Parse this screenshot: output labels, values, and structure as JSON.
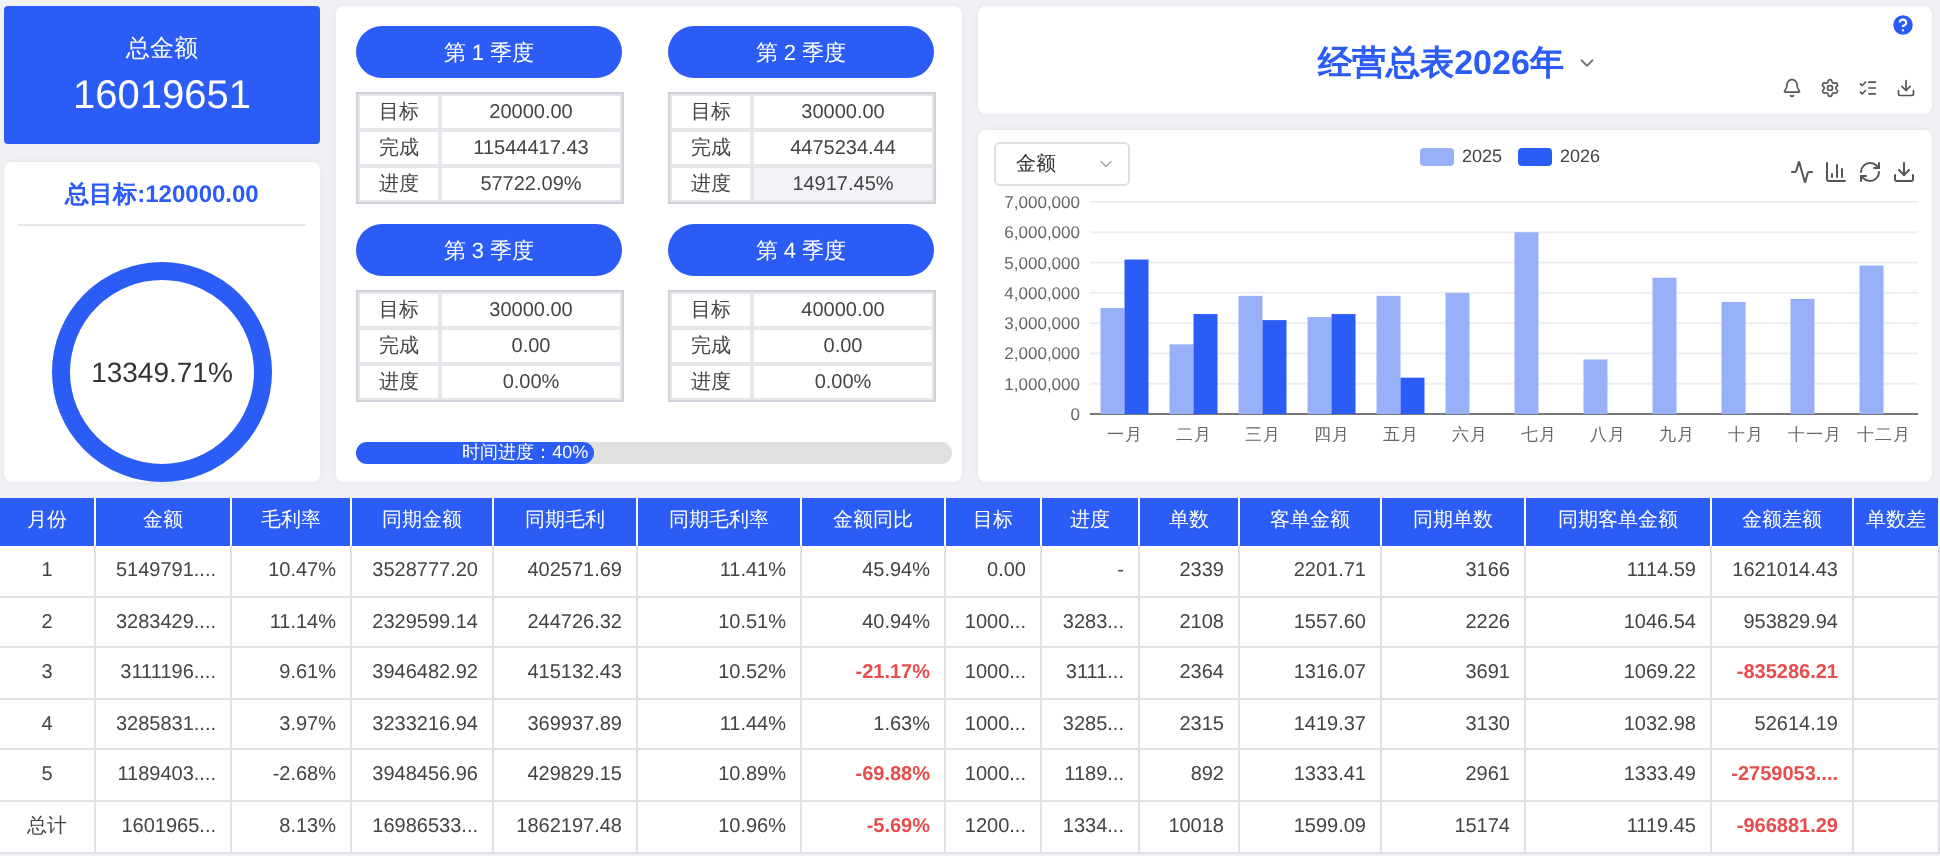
{
  "total_card": {
    "label": "总金额",
    "value": "16019651"
  },
  "target_card": {
    "title": "总目标:120000.00",
    "ring_value": "13349.71%"
  },
  "quarters": [
    {
      "title": "第 1 季度",
      "rows": [
        {
          "label": "目标",
          "value": "20000.00",
          "highlighted": false
        },
        {
          "label": "完成",
          "value": "11544417.43",
          "highlighted": false
        },
        {
          "label": "进度",
          "value": "57722.09%",
          "highlighted": false
        }
      ]
    },
    {
      "title": "第 2 季度",
      "rows": [
        {
          "label": "目标",
          "value": "30000.00",
          "highlighted": false
        },
        {
          "label": "完成",
          "value": "4475234.44",
          "highlighted": false
        },
        {
          "label": "进度",
          "value": "14917.45%",
          "highlighted": true
        }
      ]
    },
    {
      "title": "第 3 季度",
      "rows": [
        {
          "label": "目标",
          "value": "30000.00",
          "highlighted": false
        },
        {
          "label": "完成",
          "value": "0.00",
          "highlighted": false
        },
        {
          "label": "进度",
          "value": "0.00%",
          "highlighted": false
        }
      ]
    },
    {
      "title": "第 4 季度",
      "rows": [
        {
          "label": "目标",
          "value": "40000.00",
          "highlighted": false
        },
        {
          "label": "完成",
          "value": "0.00",
          "highlighted": false
        },
        {
          "label": "进度",
          "value": "0.00%",
          "highlighted": false
        }
      ]
    }
  ],
  "time_progress": {
    "label": "时间进度：40%",
    "level": 0.4
  },
  "header": {
    "title": "经营总表2026年"
  },
  "chart_panel": {
    "metric_select": "金额",
    "chart_data": {
      "type": "bar",
      "grid": true,
      "categories": [
        "一月",
        "二月",
        "三月",
        "四月",
        "五月",
        "六月",
        "七月",
        "八月",
        "九月",
        "十月",
        "十一月",
        "十二月"
      ],
      "series": [
        {
          "name": "2025",
          "color": "#98b0f8",
          "values": [
            3500000,
            2300000,
            3900000,
            3200000,
            3900000,
            4000000,
            6000000,
            1800000,
            4500000,
            3700000,
            3800000,
            4900000
          ]
        },
        {
          "name": "2026",
          "color": "#2b5cf6",
          "values": [
            5100000,
            3300000,
            3100000,
            3300000,
            1200000,
            null,
            null,
            null,
            null,
            null,
            null,
            null
          ]
        }
      ],
      "ylim": [
        0,
        7000000
      ],
      "yticks": [
        {
          "value": 0,
          "label": "0"
        },
        {
          "value": 1000000,
          "label": "1,000,000"
        },
        {
          "value": 2000000,
          "label": "2,000,000"
        },
        {
          "value": 3000000,
          "label": "3,000,000"
        },
        {
          "value": 4000000,
          "label": "4,000,000"
        },
        {
          "value": 5000000,
          "label": "5,000,000"
        },
        {
          "value": 6000000,
          "label": "6,000,000"
        },
        {
          "value": 7000000,
          "label": "7,000,000"
        }
      ]
    }
  },
  "table": {
    "columns": [
      "月份",
      "金额",
      "毛利率",
      "同期金额",
      "同期毛利",
      "同期毛利率",
      "金额同比",
      "目标",
      "进度",
      "单数",
      "客单金额",
      "同期单数",
      "同期客单金额",
      "金额差额",
      "单数差"
    ],
    "rows": [
      {
        "cells": [
          {
            "text": "1",
            "negative": false
          },
          {
            "text": "5149791....",
            "negative": false
          },
          {
            "text": "10.47%",
            "negative": false
          },
          {
            "text": "3528777.20",
            "negative": false
          },
          {
            "text": "402571.69",
            "negative": false
          },
          {
            "text": "11.41%",
            "negative": false
          },
          {
            "text": "45.94%",
            "negative": false
          },
          {
            "text": "0.00",
            "negative": false
          },
          {
            "text": "-",
            "negative": false
          },
          {
            "text": "2339",
            "negative": false
          },
          {
            "text": "2201.71",
            "negative": false
          },
          {
            "text": "3166",
            "negative": false
          },
          {
            "text": "1114.59",
            "negative": false
          },
          {
            "text": "1621014.43",
            "negative": false
          }
        ]
      },
      {
        "cells": [
          {
            "text": "2",
            "negative": false
          },
          {
            "text": "3283429....",
            "negative": false
          },
          {
            "text": "11.14%",
            "negative": false
          },
          {
            "text": "2329599.14",
            "negative": false
          },
          {
            "text": "244726.32",
            "negative": false
          },
          {
            "text": "10.51%",
            "negative": false
          },
          {
            "text": "40.94%",
            "negative": false
          },
          {
            "text": "1000...",
            "negative": false
          },
          {
            "text": "3283...",
            "negative": false
          },
          {
            "text": "2108",
            "negative": false
          },
          {
            "text": "1557.60",
            "negative": false
          },
          {
            "text": "2226",
            "negative": false
          },
          {
            "text": "1046.54",
            "negative": false
          },
          {
            "text": "953829.94",
            "negative": false
          }
        ]
      },
      {
        "cells": [
          {
            "text": "3",
            "negative": false
          },
          {
            "text": "3111196....",
            "negative": false
          },
          {
            "text": "9.61%",
            "negative": false
          },
          {
            "text": "3946482.92",
            "negative": false
          },
          {
            "text": "415132.43",
            "negative": false
          },
          {
            "text": "10.52%",
            "negative": false
          },
          {
            "text": "-21.17%",
            "negative": true
          },
          {
            "text": "1000...",
            "negative": false
          },
          {
            "text": "3111...",
            "negative": false
          },
          {
            "text": "2364",
            "negative": false
          },
          {
            "text": "1316.07",
            "negative": false
          },
          {
            "text": "3691",
            "negative": false
          },
          {
            "text": "1069.22",
            "negative": false
          },
          {
            "text": "-835286.21",
            "negative": true
          }
        ]
      },
      {
        "cells": [
          {
            "text": "4",
            "negative": false
          },
          {
            "text": "3285831....",
            "negative": false
          },
          {
            "text": "3.97%",
            "negative": false
          },
          {
            "text": "3233216.94",
            "negative": false
          },
          {
            "text": "369937.89",
            "negative": false
          },
          {
            "text": "11.44%",
            "negative": false
          },
          {
            "text": "1.63%",
            "negative": false
          },
          {
            "text": "1000...",
            "negative": false
          },
          {
            "text": "3285...",
            "negative": false
          },
          {
            "text": "2315",
            "negative": false
          },
          {
            "text": "1419.37",
            "negative": false
          },
          {
            "text": "3130",
            "negative": false
          },
          {
            "text": "1032.98",
            "negative": false
          },
          {
            "text": "52614.19",
            "negative": false
          }
        ]
      },
      {
        "cells": [
          {
            "text": "5",
            "negative": false
          },
          {
            "text": "1189403....",
            "negative": false
          },
          {
            "text": "-2.68%",
            "negative": false
          },
          {
            "text": "3948456.96",
            "negative": false
          },
          {
            "text": "429829.15",
            "negative": false
          },
          {
            "text": "10.89%",
            "negative": false
          },
          {
            "text": "-69.88%",
            "negative": true
          },
          {
            "text": "1000...",
            "negative": false
          },
          {
            "text": "1189...",
            "negative": false
          },
          {
            "text": "892",
            "negative": false
          },
          {
            "text": "1333.41",
            "negative": false
          },
          {
            "text": "2961",
            "negative": false
          },
          {
            "text": "1333.49",
            "negative": false
          },
          {
            "text": "-2759053....",
            "negative": true
          }
        ]
      },
      {
        "cells": [
          {
            "text": "总计",
            "negative": false
          },
          {
            "text": "1601965...",
            "negative": false
          },
          {
            "text": "8.13%",
            "negative": false
          },
          {
            "text": "16986533...",
            "negative": false
          },
          {
            "text": "1862197.48",
            "negative": false
          },
          {
            "text": "10.96%",
            "negative": false
          },
          {
            "text": "-5.69%",
            "negative": true
          },
          {
            "text": "1200...",
            "negative": false
          },
          {
            "text": "1334...",
            "negative": false
          },
          {
            "text": "10018",
            "negative": false
          },
          {
            "text": "1599.09",
            "negative": false
          },
          {
            "text": "15174",
            "negative": false
          },
          {
            "text": "1119.45",
            "negative": false
          },
          {
            "text": "-966881.29",
            "negative": true
          }
        ]
      }
    ]
  }
}
